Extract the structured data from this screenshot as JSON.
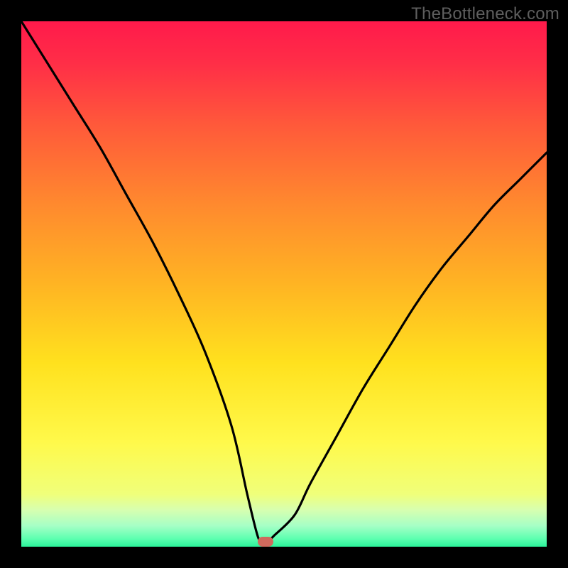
{
  "watermark": "TheBottleneck.com",
  "colors": {
    "bg": "#000000",
    "gradient_stops": [
      {
        "offset": 0.0,
        "color": "#ff1a4b"
      },
      {
        "offset": 0.08,
        "color": "#ff2e47"
      },
      {
        "offset": 0.2,
        "color": "#ff5a3a"
      },
      {
        "offset": 0.35,
        "color": "#ff8a2e"
      },
      {
        "offset": 0.5,
        "color": "#ffb423"
      },
      {
        "offset": 0.65,
        "color": "#ffe11e"
      },
      {
        "offset": 0.8,
        "color": "#fff94a"
      },
      {
        "offset": 0.9,
        "color": "#f0ff7a"
      },
      {
        "offset": 0.93,
        "color": "#d7ffb0"
      },
      {
        "offset": 0.96,
        "color": "#a6ffc6"
      },
      {
        "offset": 0.985,
        "color": "#5cffb0"
      },
      {
        "offset": 1.0,
        "color": "#2bf29a"
      }
    ],
    "curve": "#000000",
    "marker": "#cf6a5d"
  },
  "chart_data": {
    "type": "line",
    "title": "",
    "xlabel": "",
    "ylabel": "",
    "xlim": [
      0,
      100
    ],
    "ylim": [
      0,
      100
    ],
    "grid": false,
    "legend": false,
    "series": [
      {
        "name": "bottleneck-curve",
        "x": [
          0,
          5,
          10,
          15,
          20,
          25,
          30,
          35,
          40,
          43,
          45,
          46,
          47,
          48,
          52,
          55,
          60,
          65,
          70,
          75,
          80,
          85,
          90,
          95,
          100
        ],
        "values": [
          100,
          92,
          84,
          76,
          67,
          58,
          48,
          37,
          23,
          10,
          2,
          1,
          1,
          2,
          6,
          12,
          21,
          30,
          38,
          46,
          53,
          59,
          65,
          70,
          75
        ]
      }
    ],
    "annotations": [
      {
        "name": "optimum-marker",
        "x": 46.5,
        "y": 1
      }
    ]
  }
}
